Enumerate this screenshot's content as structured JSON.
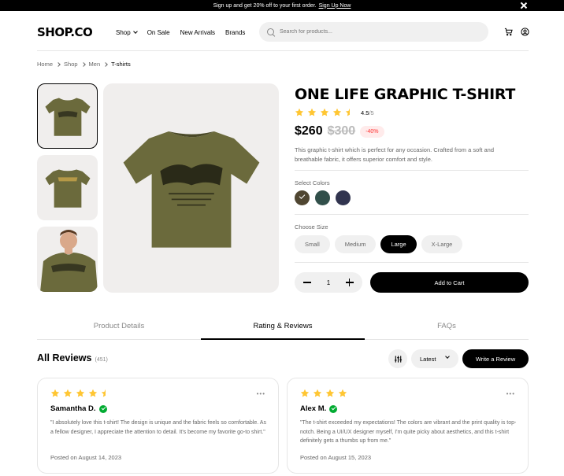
{
  "announcement": {
    "text": "Sign up and get 20% off to your first order.",
    "link": "Sign Up Now"
  },
  "header": {
    "logo": "SHOP.CO",
    "nav": [
      "Shop",
      "On Sale",
      "New Arrivals",
      "Brands"
    ],
    "search_placeholder": "Search for products..."
  },
  "breadcrumb": [
    "Home",
    "Shop",
    "Men",
    "T-shirts"
  ],
  "product": {
    "title": "ONE LIFE GRAPHIC T-SHIRT",
    "rating": 4.5,
    "rating_value": "4.5",
    "rating_denominator": "/5",
    "price": "$260",
    "old_price": "$300",
    "discount": "-40%",
    "description": "This graphic t-shirt which is perfect for any occasion. Crafted from a soft and breathable fabric, it offers superior comfort and style.",
    "colors_label": "Select Colors",
    "colors": [
      "#4f4631",
      "#314f4a",
      "#31344f"
    ],
    "selected_color_index": 0,
    "size_label": "Choose Size",
    "sizes": [
      "Small",
      "Medium",
      "Large",
      "X-Large"
    ],
    "selected_size": "Large",
    "quantity": "1",
    "add_to_cart": "Add to Cart",
    "shirt_color": "#6b6a3c"
  },
  "tabs": [
    "Product Details",
    "Rating & Reviews",
    "FAQs"
  ],
  "active_tab": "Rating & Reviews",
  "reviews": {
    "heading": "All Reviews",
    "count": "(451)",
    "sort": "Latest",
    "write_label": "Write a Review",
    "items": [
      {
        "rating": 4.5,
        "name": "Samantha D.",
        "text": "\"I absolutely love this t-shirt! The design is unique and the fabric feels so comfortable. As a fellow designer, I appreciate the attention to detail. It's become my favorite go-to shirt.\"",
        "date": "Posted on August 14, 2023"
      },
      {
        "rating": 4,
        "name": "Alex M.",
        "text": "\"The t-shirt exceeded my expectations! The colors are vibrant and the print quality is top-notch. Being a UI/UX designer myself, I'm quite picky about aesthetics, and this t-shirt definitely gets a thumbs up from me.\"",
        "date": "Posted on August 15, 2023"
      }
    ]
  },
  "colors": {
    "star": "#ffc633",
    "verified": "#01ab31",
    "discount": "#ff3333"
  }
}
